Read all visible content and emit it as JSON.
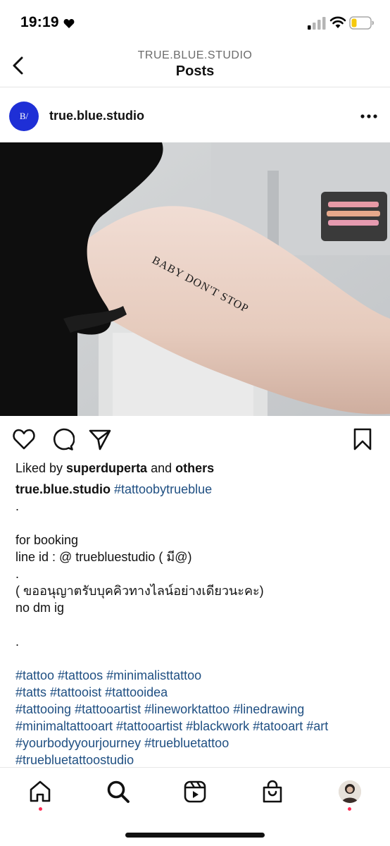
{
  "status_bar": {
    "time": "19:19"
  },
  "nav": {
    "subtitle": "TRUE.BLUE.STUDIO",
    "title": "Posts"
  },
  "post": {
    "avatar_text": "B/",
    "username": "true.blue.studio",
    "photo_text": "BABY DON'T STOP",
    "liked_prefix": "Liked by ",
    "liked_user": "superduperta",
    "liked_mid": " and ",
    "liked_others": "others",
    "caption_user": "true.blue.studio",
    "caption_first_tag": "#tattoobytrueblue",
    "caption_lines": [
      ".",
      "",
      "for booking",
      "line id : @ truebluestudio ( มี@)",
      ".",
      "( ขออนุญาตรับบุคคิวทางไลน์อย่างเดียวนะคะ)",
      "no dm ig",
      "",
      ".",
      ""
    ],
    "hashtag_lines": [
      "#tattoo #tattoos #minimalisttattoo",
      "#tatts  #tattooist  #tattooidea",
      "#tattooing #tattooartist  #lineworktattoo #linedrawing",
      "#minimaltattooart #tattooartist  #blackwork  #tatooart #art",
      "#yourbodyyourjourney #truebluetattoo",
      "#truebluetattoostudio"
    ]
  },
  "colors": {
    "accent_link": "#1f4f82",
    "avatar_bg": "#1e2fd6",
    "notification_dot": "#ff2d55"
  },
  "icons": {
    "back": "chevron-left-icon",
    "more": "more-dots-icon",
    "like": "heart-icon",
    "comment": "comment-icon",
    "share": "send-icon",
    "save": "bookmark-icon",
    "home": "home-icon",
    "search": "search-icon",
    "reels": "reels-icon",
    "shop": "shop-bag-icon"
  }
}
